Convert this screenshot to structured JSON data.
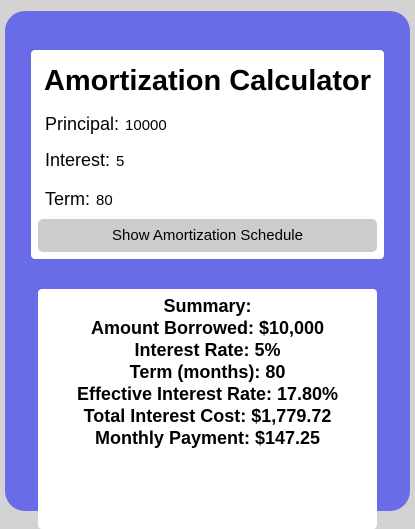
{
  "calculator": {
    "title": "Amortization Calculator",
    "principal": {
      "label": "Principal:",
      "value": "10000"
    },
    "interest": {
      "label": "Interest:",
      "value": "5"
    },
    "term": {
      "label": "Term:",
      "value": "80"
    },
    "show_button_label": "Show Amortization Schedule"
  },
  "summary": {
    "heading": "Summary:",
    "lines": [
      "Amount Borrowed: $10,000",
      "Interest Rate: 5%",
      "Term (months): 80",
      "Effective Interest Rate: 17.80%",
      "Total Interest Cost: $1,779.72",
      "Monthly Payment: $147.25"
    ]
  },
  "colors": {
    "background": "#d3d3d3",
    "panel": "#6a6be6",
    "card": "#ffffff",
    "button": "#cccccc"
  }
}
